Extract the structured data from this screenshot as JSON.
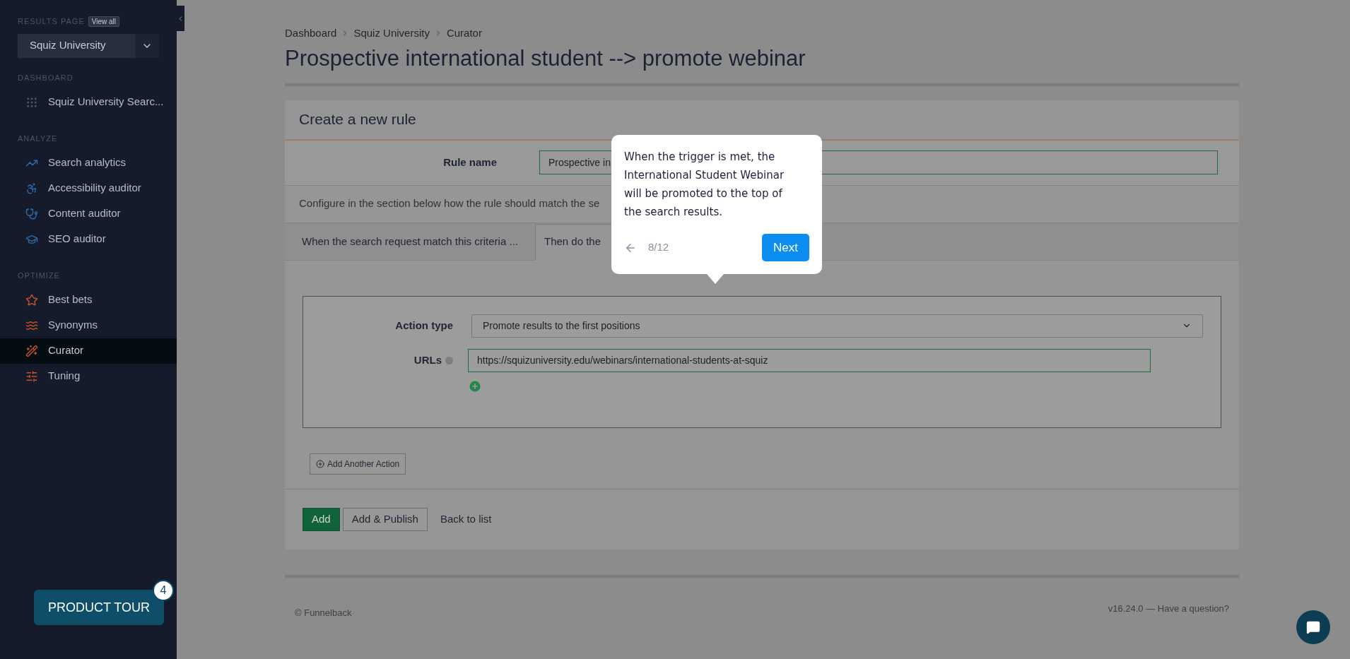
{
  "sidebar": {
    "results_page": {
      "label": "RESULTS PAGE",
      "view_all": "View all",
      "select_value": "Squiz University"
    },
    "sections": [
      {
        "heading": "DASHBOARD",
        "items": [
          {
            "label": "Squiz University Searc...",
            "selected": false
          }
        ]
      },
      {
        "heading": "ANALYZE",
        "items": [
          {
            "label": "Search analytics",
            "selected": false
          },
          {
            "label": "Accessibility auditor",
            "selected": false
          },
          {
            "label": "Content auditor",
            "selected": false
          },
          {
            "label": "SEO auditor",
            "selected": false
          }
        ]
      },
      {
        "heading": "OPTIMIZE",
        "items": [
          {
            "label": "Best bets",
            "selected": false
          },
          {
            "label": "Synonyms",
            "selected": false
          },
          {
            "label": "Curator",
            "selected": true
          },
          {
            "label": "Tuning",
            "selected": false
          }
        ]
      }
    ],
    "product_tour": {
      "label": "PRODUCT TOUR",
      "badge": "4"
    }
  },
  "breadcrumb": [
    "Dashboard",
    "Squiz University",
    "Curator"
  ],
  "title": "Prospective international student --> promote webinar",
  "card": {
    "title": "Create a new rule",
    "rule_name": {
      "label": "Rule name",
      "value": "Prospective in"
    },
    "description": "Configure in the section below how the rule should match the se",
    "tabs": [
      {
        "label": "When the search request match this criteria ...",
        "selected": false
      },
      {
        "label": "Then do the",
        "selected": true
      }
    ],
    "action": {
      "type_label": "Action type",
      "type_value": "Promote results to the first positions",
      "urls_label": "URLs",
      "url_value": "https://squizuniversity.edu/webinars/international-students-at-squiz"
    },
    "add_action": "Add Another Action",
    "buttons": [
      {
        "label": "Add",
        "kind": "primary"
      },
      {
        "label": "Add & Publish",
        "kind": "secondary"
      },
      {
        "label": "Back to list",
        "kind": "link"
      }
    ]
  },
  "footer": {
    "copyright": "© Funnelback",
    "version": "v16.24.0 — Have a question?"
  },
  "tour_popover": {
    "text": "When the trigger is met, the International Student Webinar will be promoted to the top of the search results.",
    "step": "8/12",
    "next": "Next"
  }
}
